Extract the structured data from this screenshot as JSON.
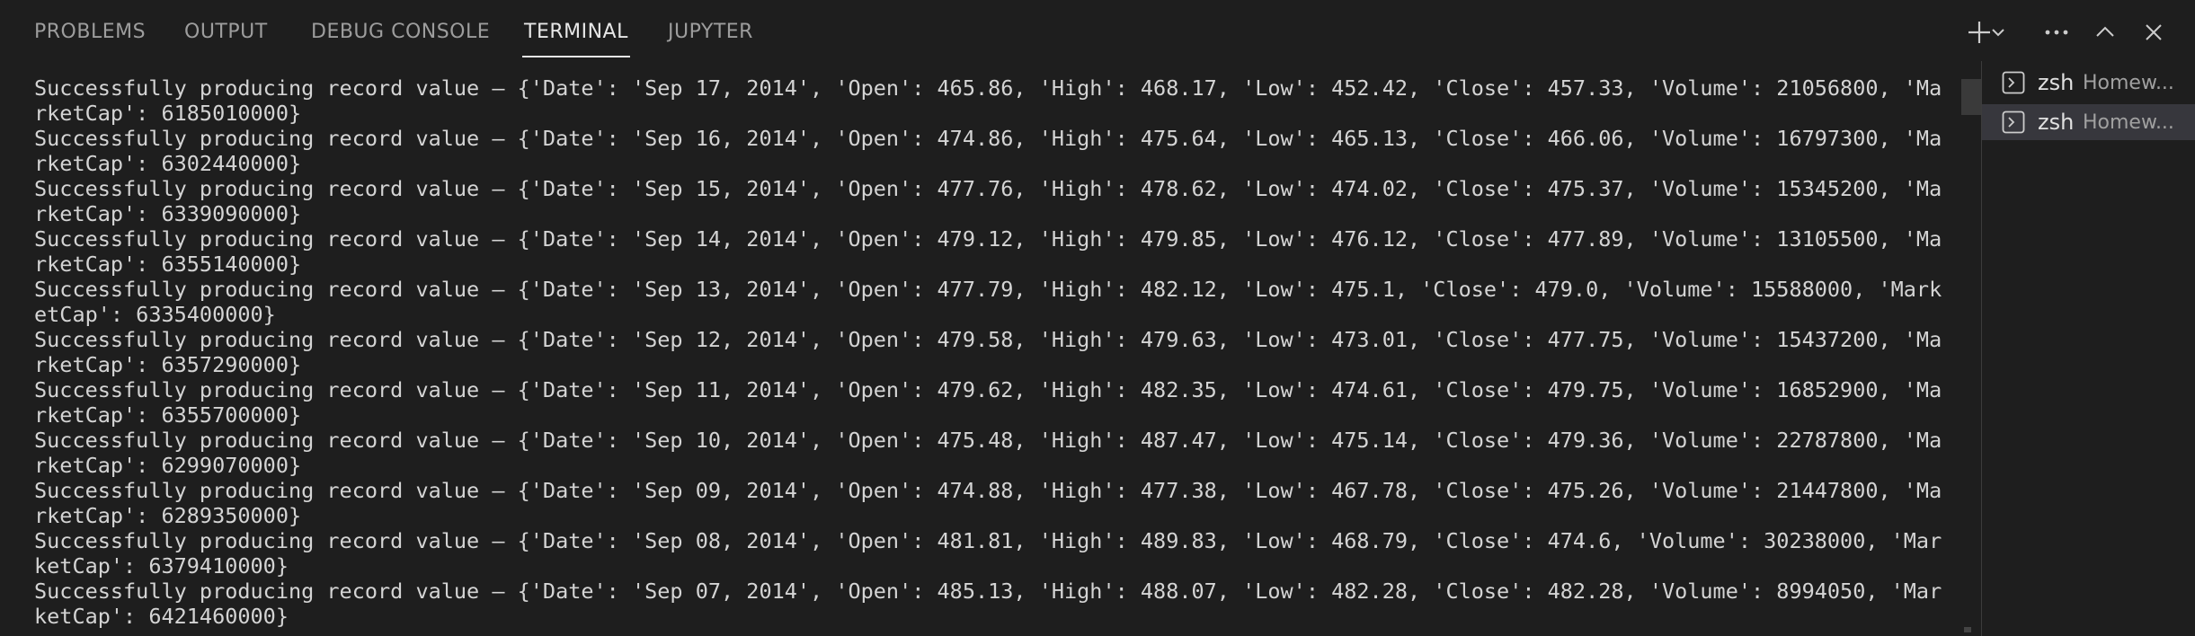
{
  "tabs": [
    {
      "label": "PROBLEMS"
    },
    {
      "label": "OUTPUT"
    },
    {
      "label": "DEBUG CONSOLE"
    },
    {
      "label": "TERMINAL"
    },
    {
      "label": "JUPYTER"
    }
  ],
  "active_tab": "TERMINAL",
  "toolbar": {
    "new_terminal_icon": "plus-icon",
    "dropdown_icon": "chevron-down-icon",
    "more_icon": "ellipsis-icon",
    "maximize_icon": "chevron-up-icon",
    "close_icon": "close-icon"
  },
  "terminal": {
    "lines": [
      "Successfully producing record value – {'Date': 'Sep 17, 2014', 'Open': 465.86, 'High': 468.17, 'Low': 452.42, 'Close': 457.33, 'Volume': 21056800, 'MarketCap': 6185010000}",
      "Successfully producing record value – {'Date': 'Sep 16, 2014', 'Open': 474.86, 'High': 475.64, 'Low': 465.13, 'Close': 466.06, 'Volume': 16797300, 'MarketCap': 6302440000}",
      "Successfully producing record value – {'Date': 'Sep 15, 2014', 'Open': 477.76, 'High': 478.62, 'Low': 474.02, 'Close': 475.37, 'Volume': 15345200, 'MarketCap': 6339090000}",
      "Successfully producing record value – {'Date': 'Sep 14, 2014', 'Open': 479.12, 'High': 479.85, 'Low': 476.12, 'Close': 477.89, 'Volume': 13105500, 'MarketCap': 6355140000}",
      "Successfully producing record value – {'Date': 'Sep 13, 2014', 'Open': 477.79, 'High': 482.12, 'Low': 475.1, 'Close': 479.0, 'Volume': 15588000, 'MarketCap': 6335400000}",
      "Successfully producing record value – {'Date': 'Sep 12, 2014', 'Open': 479.58, 'High': 479.63, 'Low': 473.01, 'Close': 477.75, 'Volume': 15437200, 'MarketCap': 6357290000}",
      "Successfully producing record value – {'Date': 'Sep 11, 2014', 'Open': 479.62, 'High': 482.35, 'Low': 474.61, 'Close': 479.75, 'Volume': 16852900, 'MarketCap': 6355700000}",
      "Successfully producing record value – {'Date': 'Sep 10, 2014', 'Open': 475.48, 'High': 487.47, 'Low': 475.14, 'Close': 479.36, 'Volume': 22787800, 'MarketCap': 6299070000}",
      "Successfully producing record value – {'Date': 'Sep 09, 2014', 'Open': 474.88, 'High': 477.38, 'Low': 467.78, 'Close': 475.26, 'Volume': 21447800, 'MarketCap': 6289350000}",
      "Successfully producing record value – {'Date': 'Sep 08, 2014', 'Open': 481.81, 'High': 489.83, 'Low': 468.79, 'Close': 474.6, 'Volume': 30238000, 'MarketCap': 6379410000}",
      "Successfully producing record value – {'Date': 'Sep 07, 2014', 'Open': 485.13, 'High': 488.07, 'Low': 482.28, 'Close': 482.28, 'Volume': 8994050, 'MarketCap': 6421460000}"
    ]
  },
  "terminal_list": [
    {
      "name": "zsh",
      "desc": "Homew...",
      "selected": false
    },
    {
      "name": "zsh",
      "desc": "Homew...",
      "selected": true
    }
  ],
  "colors": {
    "background": "#1e1e1e",
    "active_tab": "#e7e7e7",
    "inactive_tab": "#9d9d9d",
    "selected_item": "#37373d"
  }
}
